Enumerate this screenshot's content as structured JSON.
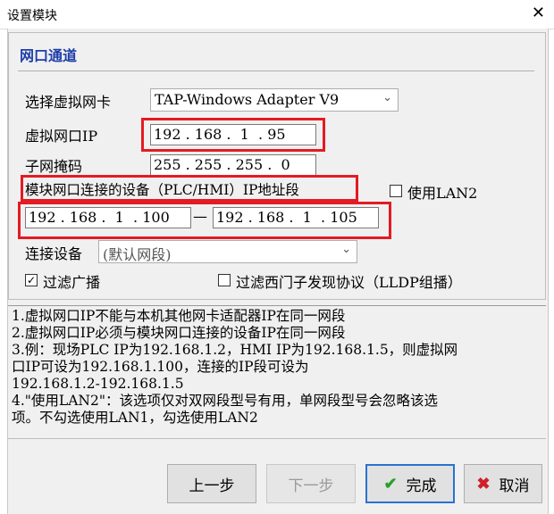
{
  "window": {
    "title": "设置模块",
    "close_glyph": "✕"
  },
  "section": {
    "title": "网口通道"
  },
  "adapter": {
    "label": "选择虚拟网卡",
    "value": "TAP-Windows Adapter V9"
  },
  "virtual_ip": {
    "label": "虚拟网口IP",
    "value": "192 . 168 .  1  . 95"
  },
  "subnet": {
    "label": "子网掩码",
    "value": "255 . 255 . 255 .  0"
  },
  "device_ip": {
    "label": "模块网口连接的设备（PLC/HMI）IP地址段",
    "start": "192 . 168 .  1  . 100",
    "separator": "—",
    "end": "192 . 168 .  1  . 105"
  },
  "use_lan2": {
    "label": "使用LAN2",
    "checked": false
  },
  "connect_device": {
    "label": "连接设备",
    "value": "(默认网段)"
  },
  "filter_broadcast": {
    "label": "过滤广播",
    "check_glyph": "✓"
  },
  "filter_siemens": {
    "label": "过滤西门子发现协议（LLDP组播）"
  },
  "notes": [
    "1.虚拟网口IP不能与本机其他网卡适配器IP在同一网段",
    "2.虚拟网口IP必须与模块网口连接的设备IP在同一网段",
    "3.例：现场PLC IP为192.168.1.2，HMI IP为192.168.1.5，则虚拟网",
    "口IP可设为192.168.1.100，连接的IP段可设为",
    "192.168.1.2-192.168.1.5",
    "4.\"使用LAN2\"：该选项仅对双网段型号有用，单网段型号会忽略该选",
    "项。不勾选使用LAN1，勾选使用LAN2"
  ],
  "buttons": {
    "prev": "上一步",
    "next": "下一步",
    "finish": "完成",
    "cancel": "取消",
    "finish_icon": "✔",
    "cancel_icon": "✖"
  },
  "icons": {
    "dropdown": "chevron-down-icon"
  },
  "colors": {
    "highlight": "#e31b23",
    "section_title": "#1e3ea8"
  }
}
